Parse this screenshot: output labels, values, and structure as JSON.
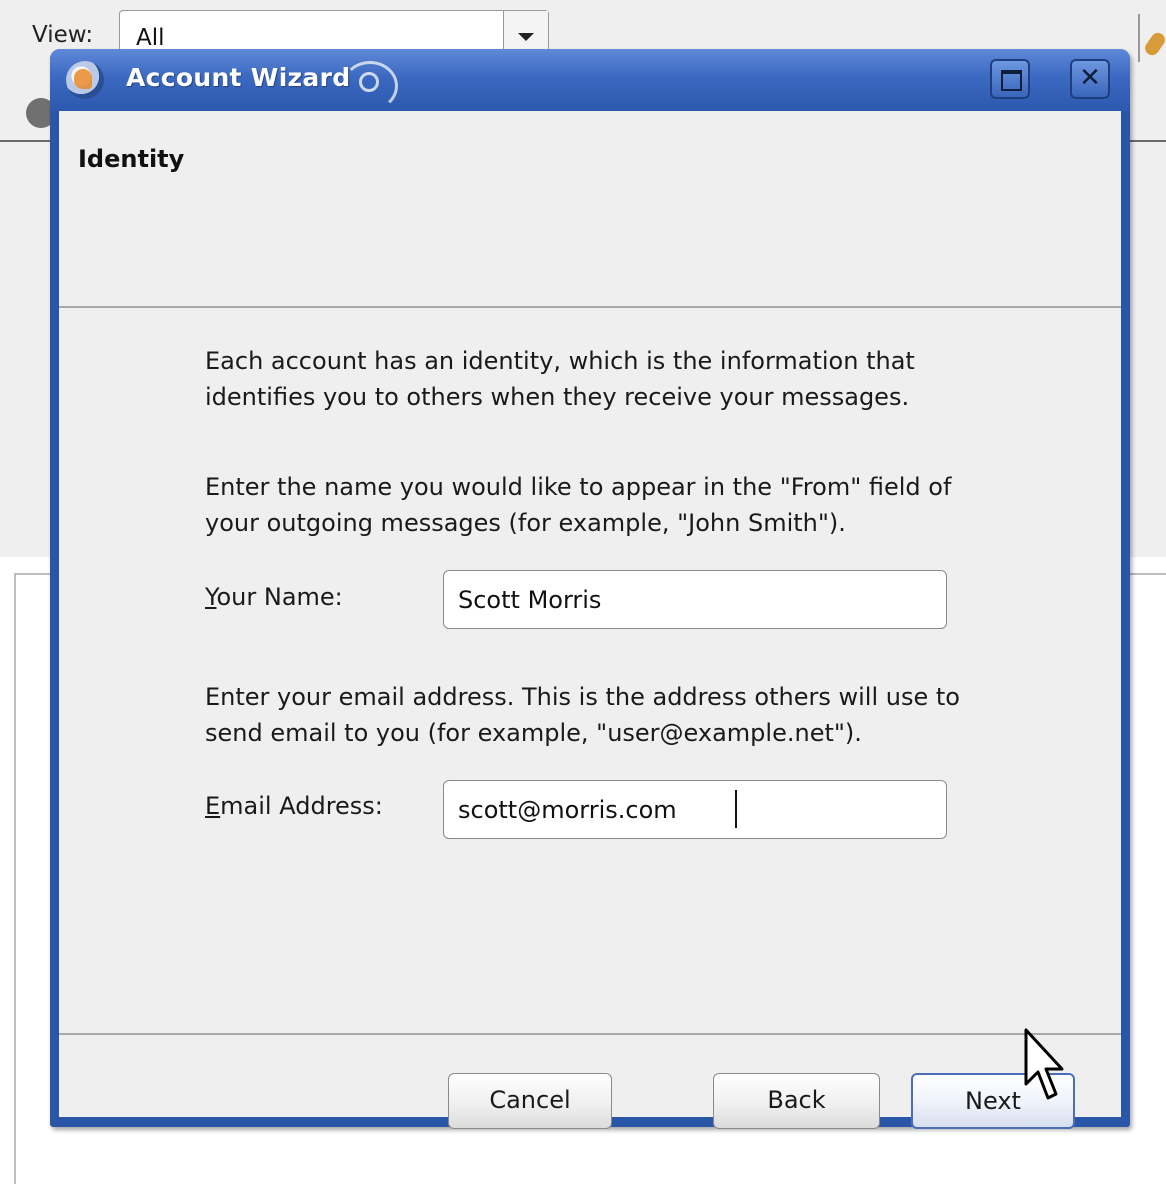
{
  "background_app": {
    "view_label": "View:",
    "view_select_value": "All"
  },
  "dialog": {
    "title": "Account Wizard",
    "page_heading": "Identity",
    "intro_text": "Each account has an identity, which is the information that identifies you to others when they receive your messages.",
    "name_prompt": "Enter the name you would like to appear in the \"From\" field of your outgoing messages (for example, \"John Smith\").",
    "name_label_mnemonic": "Y",
    "name_label_rest": "our Name:",
    "name_value": "Scott Morris",
    "email_prompt": "Enter your email address. This is the address others will use to send email to you (for example, \"user@example.net\").",
    "email_label_mnemonic": "E",
    "email_label_rest": "mail Address:",
    "email_value": "scott@morris.com",
    "buttons": {
      "cancel": "Cancel",
      "back": "Back",
      "next": "Next"
    }
  },
  "colors": {
    "titlebar": "#3c69c1",
    "dialog_border": "#2a56a8",
    "body_background": "#efefef",
    "default_button_border": "#4a6fb8"
  },
  "icons": {
    "app_icon": "thunderbird-icon",
    "maximize": "maximize-icon",
    "close": "close-icon",
    "pointer": "mouse-cursor-icon"
  }
}
